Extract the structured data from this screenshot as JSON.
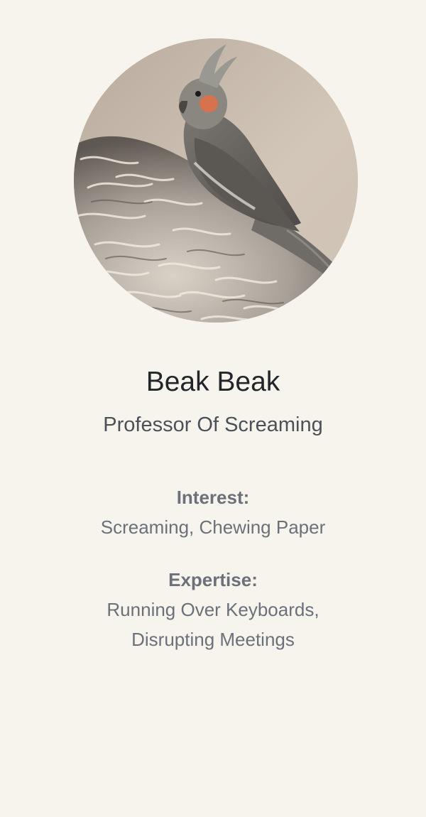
{
  "profile": {
    "name": "Beak Beak",
    "title": "Professor Of Screaming",
    "interest_label": "Interest:",
    "interest_value": "Screaming, Chewing Paper",
    "expertise_label": "Expertise:",
    "expertise_lines": [
      "Running Over Keyboards,",
      "Disrupting Meetings"
    ]
  },
  "colors": {
    "page_background": "#f7f4ee",
    "name_text": "#22252a",
    "title_text": "#4c5057",
    "detail_text": "#6b7079"
  },
  "avatar": {
    "subject": "cockatiel-on-fur-rug"
  }
}
